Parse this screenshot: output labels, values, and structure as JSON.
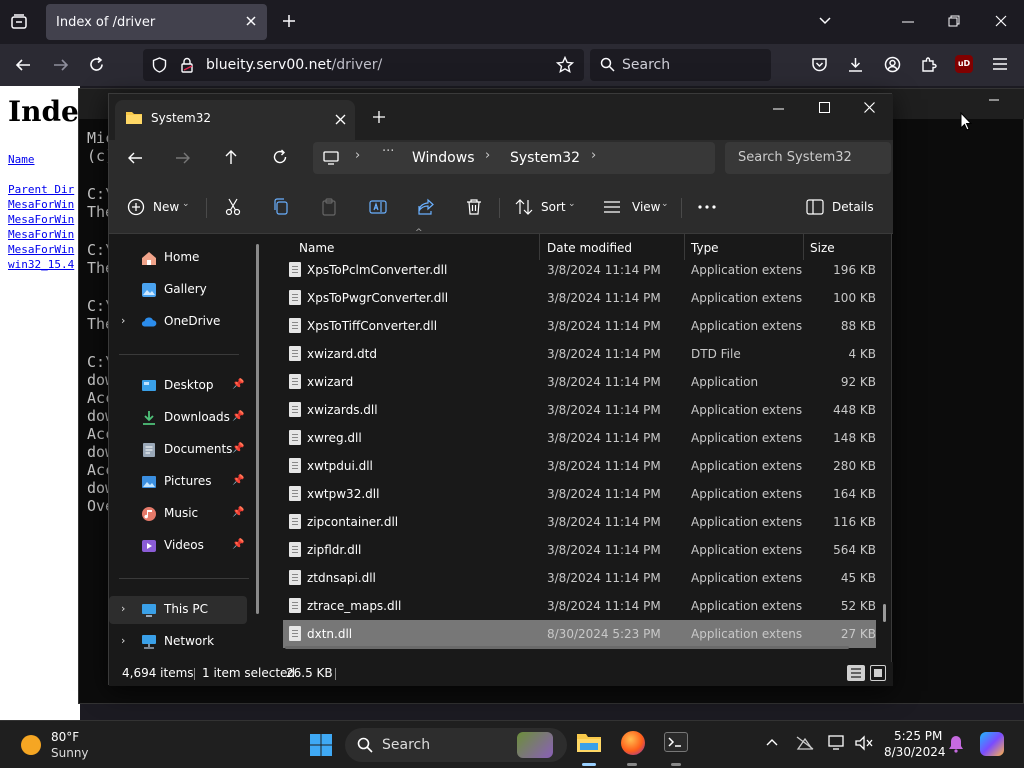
{
  "browser": {
    "tab_title": "Index of /driver",
    "url_domain": "blueity.serv00.net",
    "url_path": "/driver/",
    "search_placeholder": "Search",
    "ext_badge": "uD"
  },
  "webpage": {
    "heading": "Index",
    "links": [
      "Name",
      "Parent Dir",
      "MesaForWin",
      "MesaForWin",
      "MesaForWin",
      "MesaForWin",
      "win32_15.4"
    ]
  },
  "terminal": {
    "lines": [
      "Mic",
      "(c)",
      "C:\\",
      "The",
      "C:\\",
      "The",
      "C:\\",
      "The",
      "C:\\",
      "dow",
      "Acc",
      "dow",
      "Acc",
      "dow",
      "Acc",
      "dow",
      "Ove"
    ]
  },
  "explorer": {
    "tab_title": "System32",
    "breadcrumb": [
      "Windows",
      "System32"
    ],
    "search_placeholder": "Search System32",
    "commands": {
      "new": "New",
      "sort": "Sort",
      "view": "View",
      "details": "Details"
    },
    "nav": {
      "home": "Home",
      "gallery": "Gallery",
      "onedrive": "OneDrive",
      "desktop": "Desktop",
      "downloads": "Downloads",
      "documents": "Documents",
      "pictures": "Pictures",
      "music": "Music",
      "videos": "Videos",
      "thispc": "This PC",
      "network": "Network"
    },
    "columns": {
      "name": "Name",
      "date": "Date modified",
      "type": "Type",
      "size": "Size"
    },
    "rows": [
      {
        "name": "XpsToPclmConverter.dll",
        "date": "3/8/2024 11:14 PM",
        "type": "Application extens...",
        "size": "196 KB"
      },
      {
        "name": "XpsToPwgrConverter.dll",
        "date": "3/8/2024 11:14 PM",
        "type": "Application extens...",
        "size": "100 KB"
      },
      {
        "name": "XpsToTiffConverter.dll",
        "date": "3/8/2024 11:14 PM",
        "type": "Application extens...",
        "size": "88 KB"
      },
      {
        "name": "xwizard.dtd",
        "date": "3/8/2024 11:14 PM",
        "type": "DTD File",
        "size": "4 KB"
      },
      {
        "name": "xwizard",
        "date": "3/8/2024 11:14 PM",
        "type": "Application",
        "size": "92 KB"
      },
      {
        "name": "xwizards.dll",
        "date": "3/8/2024 11:14 PM",
        "type": "Application extens...",
        "size": "448 KB"
      },
      {
        "name": "xwreg.dll",
        "date": "3/8/2024 11:14 PM",
        "type": "Application extens...",
        "size": "148 KB"
      },
      {
        "name": "xwtpdui.dll",
        "date": "3/8/2024 11:14 PM",
        "type": "Application extens...",
        "size": "280 KB"
      },
      {
        "name": "xwtpw32.dll",
        "date": "3/8/2024 11:14 PM",
        "type": "Application extens...",
        "size": "164 KB"
      },
      {
        "name": "zipcontainer.dll",
        "date": "3/8/2024 11:14 PM",
        "type": "Application extens...",
        "size": "116 KB"
      },
      {
        "name": "zipfldr.dll",
        "date": "3/8/2024 11:14 PM",
        "type": "Application extens...",
        "size": "564 KB"
      },
      {
        "name": "ztdnsapi.dll",
        "date": "3/8/2024 11:14 PM",
        "type": "Application extens...",
        "size": "45 KB"
      },
      {
        "name": "ztrace_maps.dll",
        "date": "3/8/2024 11:14 PM",
        "type": "Application extens...",
        "size": "52 KB"
      },
      {
        "name": "dxtn.dll",
        "date": "8/30/2024 5:23 PM",
        "type": "Application extens...",
        "size": "27 KB"
      }
    ],
    "status": {
      "items": "4,694 items",
      "selected": "1 item selected",
      "size": "26.5 KB"
    }
  },
  "taskbar": {
    "weather_temp": "80°F",
    "weather_desc": "Sunny",
    "search_label": "Search",
    "time": "5:25 PM",
    "date": "8/30/2024"
  }
}
